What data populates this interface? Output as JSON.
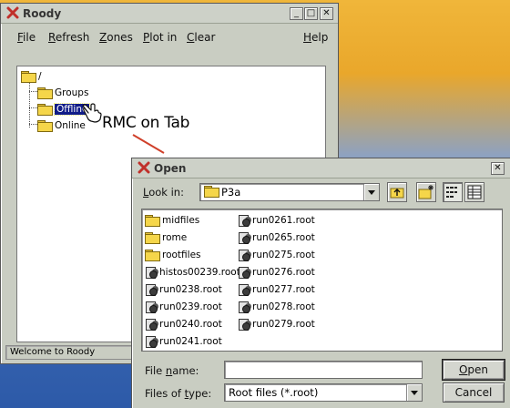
{
  "roody": {
    "title": "Roody",
    "menu": [
      "File",
      "Refresh",
      "Zones",
      "Plot in",
      "Clear"
    ],
    "help": "Help",
    "tree": {
      "root": "/",
      "children": [
        "Groups",
        "Offline",
        "Online"
      ],
      "selected": "Offline"
    },
    "status": "Welcome to Roody"
  },
  "annotation": "RMC on Tab",
  "open_dialog": {
    "title": "Open",
    "look_in_label": "Look in:",
    "look_in_value": "P3a",
    "files_col1": [
      {
        "name": "midfiles",
        "type": "folder"
      },
      {
        "name": "rome",
        "type": "folder"
      },
      {
        "name": "rootfiles",
        "type": "folder"
      },
      {
        "name": "histos00239.root",
        "type": "root"
      },
      {
        "name": "run0238.root",
        "type": "root"
      },
      {
        "name": "run0239.root",
        "type": "root"
      },
      {
        "name": "run0240.root",
        "type": "root"
      },
      {
        "name": "run0241.root",
        "type": "root"
      }
    ],
    "files_col2": [
      {
        "name": "run0261.root",
        "type": "root"
      },
      {
        "name": "run0265.root",
        "type": "root"
      },
      {
        "name": "run0275.root",
        "type": "root"
      },
      {
        "name": "run0276.root",
        "type": "root"
      },
      {
        "name": "run0277.root",
        "type": "root"
      },
      {
        "name": "run0278.root",
        "type": "root"
      },
      {
        "name": "run0279.root",
        "type": "root"
      }
    ],
    "file_name_label": "File name:",
    "file_name_value": "",
    "files_of_type_label": "Files of type:",
    "files_of_type_value": "Root files (*.root)",
    "open_button": "Open",
    "cancel_button": "Cancel"
  },
  "colors": {
    "selection": "#101c88",
    "window_bg": "#c9cdc2",
    "annotation_arrow": "#d0402a"
  }
}
